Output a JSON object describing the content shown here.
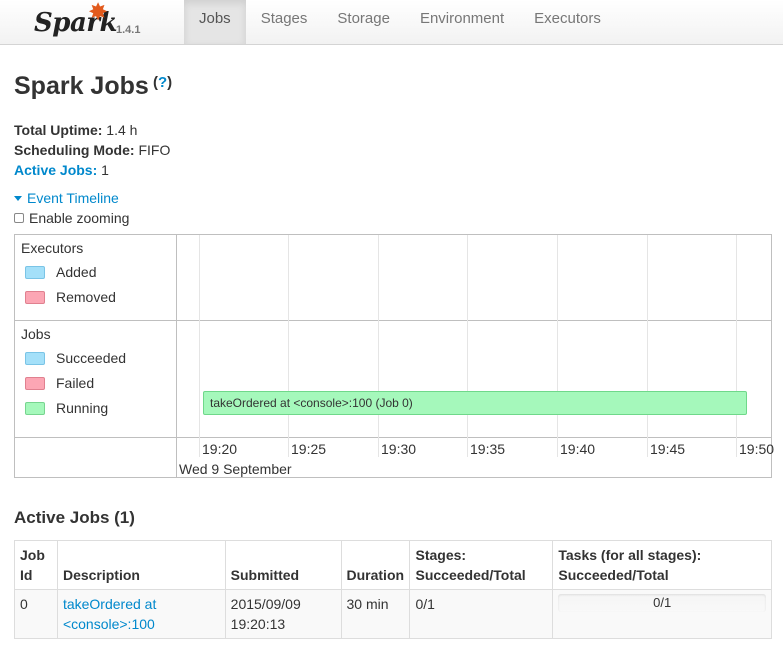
{
  "nav": {
    "brand": "Spark",
    "version": "1.4.1",
    "tabs": [
      {
        "label": "Jobs",
        "active": true
      },
      {
        "label": "Stages",
        "active": false
      },
      {
        "label": "Storage",
        "active": false
      },
      {
        "label": "Environment",
        "active": false
      },
      {
        "label": "Executors",
        "active": false
      }
    ]
  },
  "header": {
    "title": "Spark Jobs",
    "help": "?"
  },
  "summary": {
    "uptime_label": "Total Uptime:",
    "uptime_value": "1.4 h",
    "mode_label": "Scheduling Mode:",
    "mode_value": "FIFO",
    "active_label": "Active Jobs:",
    "active_value": "1"
  },
  "timeline": {
    "toggle_label": "Event Timeline",
    "zoom_label": "Enable zooming",
    "executors": {
      "title": "Executors",
      "legend": [
        "Added",
        "Removed"
      ]
    },
    "jobs": {
      "title": "Jobs",
      "legend": [
        "Succeeded",
        "Failed",
        "Running"
      ]
    },
    "axis_ticks": [
      "19:20",
      "19:25",
      "19:30",
      "19:35",
      "19:40",
      "19:45",
      "19:50"
    ],
    "axis_date": "Wed 9 September",
    "job_bar": "takeOrdered at <console>:100 (Job 0)",
    "colors": {
      "added": "#a4e0f9",
      "removed": "#fca6b4",
      "succeeded": "#a4e0f9",
      "failed": "#fca6b4",
      "running": "#a5f8bb"
    }
  },
  "active_jobs": {
    "title": "Active Jobs (1)",
    "headers": [
      "Job Id",
      "Description",
      "Submitted",
      "Duration",
      "Stages: Succeeded/Total",
      "Tasks (for all stages): Succeeded/Total"
    ],
    "rows": [
      {
        "job_id": "0",
        "description": "takeOrdered at <console>:100",
        "submitted": "2015/09/09 19:20:13",
        "duration": "30 min",
        "stages": "0/1",
        "tasks": "0/1",
        "tasks_progress": 0
      }
    ]
  }
}
